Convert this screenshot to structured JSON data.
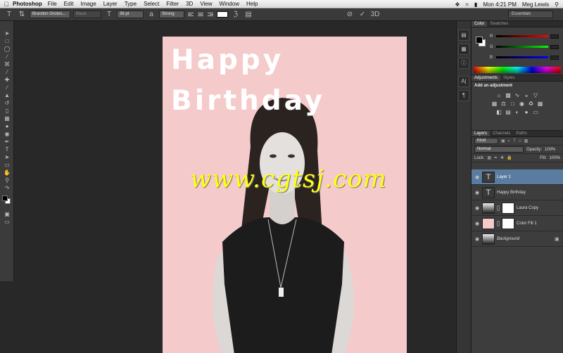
{
  "menubar": {
    "app_name": "Photoshop",
    "items": [
      "File",
      "Edit",
      "Image",
      "Layer",
      "Type",
      "Select",
      "Filter",
      "3D",
      "View",
      "Window",
      "Help"
    ],
    "clock": "Mon 4:21 PM",
    "user": "Meg Lewis"
  },
  "options_bar": {
    "font_family": "Brandon Grotes...",
    "font_style": "Black",
    "font_size": "36 pt",
    "antialias": "Strong",
    "text_color": "#ffffff",
    "workspace": "Essentials"
  },
  "document": {
    "title_lines": [
      "Happy",
      "Birthday"
    ],
    "background_color": "#f5caca"
  },
  "watermark": "www.cgtsj.com",
  "color_panel": {
    "tabs": [
      "Color",
      "Swatches"
    ],
    "channels": [
      "R",
      "G",
      "B"
    ]
  },
  "adjustments_panel": {
    "tabs": [
      "Adjustments",
      "Styles"
    ],
    "heading": "Add an adjustment"
  },
  "layers_panel": {
    "tabs": [
      "Layers",
      "Channels",
      "Paths"
    ],
    "filter": "Kind",
    "blend_mode": "Normal",
    "opacity_label": "Opacity:",
    "opacity": "100%",
    "lock_label": "Lock:",
    "fill_label": "Fill:",
    "fill": "100%",
    "layers": [
      {
        "name": "Layer 1",
        "selected": true
      },
      {
        "name": "Happy Birthday",
        "selected": false
      },
      {
        "name": "Laura Copy",
        "selected": false
      },
      {
        "name": "Color Fill 1",
        "selected": false
      },
      {
        "name": "Background",
        "selected": false
      }
    ]
  },
  "colors": {
    "selection": "#5a7ca0",
    "watermark": "#ffff11"
  }
}
